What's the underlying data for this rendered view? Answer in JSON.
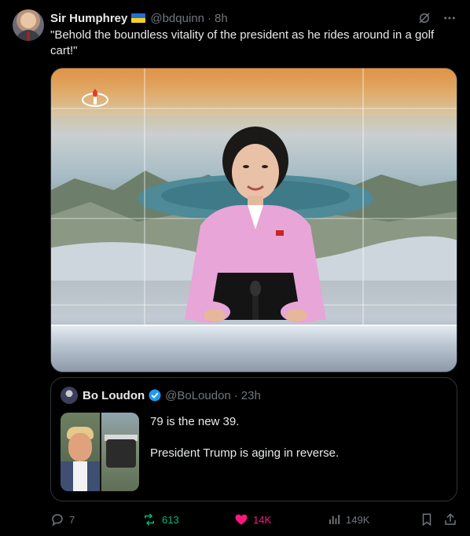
{
  "tweet": {
    "author_name": "Sir Humphrey",
    "flag_icon": "ukraine-flag-icon",
    "handle": "@bdquinn",
    "separator": "·",
    "time": "8h",
    "text": "\"Behold the boundless vitality of the president as he rides around in a golf cart!\"",
    "media_icon": "news-broadcast-image"
  },
  "quoted": {
    "author_name": "Bo Loudon",
    "verified_icon": "verified-badge-icon",
    "handle": "@BoLoudon",
    "separator": "·",
    "time": "23h",
    "line1": "79 is the new 39.",
    "line2": "President Trump is aging in reverse."
  },
  "actions": {
    "replies": "7",
    "retweets": "613",
    "likes": "14K",
    "views": "149K"
  },
  "colors": {
    "background": "#000000",
    "text": "#e7e9ea",
    "muted": "#71767b",
    "border": "#2f3336",
    "retweet_active": "#00ba7c",
    "like_active": "#f91880",
    "verified": "#1d9bf0"
  }
}
